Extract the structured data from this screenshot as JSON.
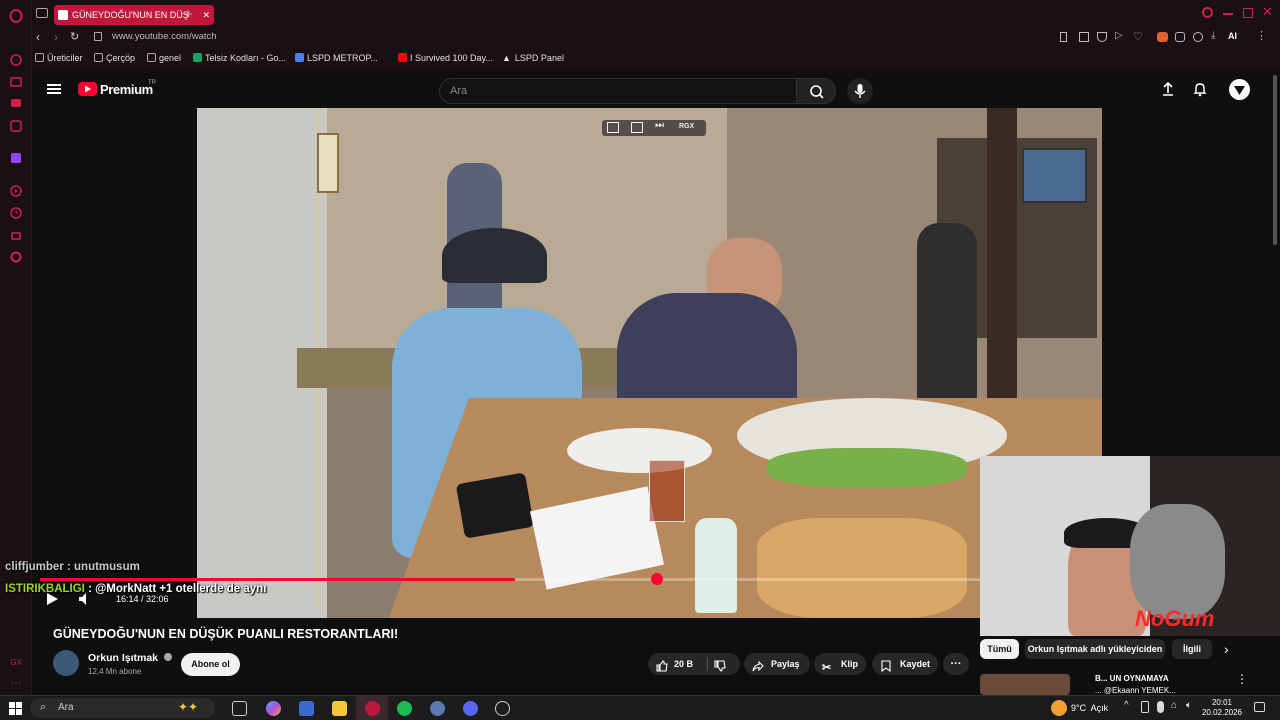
{
  "browser": {
    "tab_title": "GÜNEYDOĞU'NUN EN DÜŞ",
    "url": "www.youtube.com/watch",
    "ai_label": "AI",
    "bookmarks": [
      "Üreticiler",
      "Çerçöp",
      "genel",
      "Telsiz Kodları - Go...",
      "LSPD METROP...",
      "I Survived 100 Day...",
      "LSPD Panel"
    ]
  },
  "youtube": {
    "logo": "Premium",
    "region": "TR",
    "search_placeholder": "Ara",
    "video_overlay_label": "RGX",
    "video_title": "GÜNEYDOĞU'NUN EN DÜŞÜK PUANLI RESTORANTLARI!",
    "channel_name": "Orkun Işıtmak",
    "subscribers": "12,4 Mn abone",
    "subscribe_label": "Abone ol",
    "likes": "20 B",
    "share_label": "Paylaş",
    "clip_label": "Klip",
    "save_label": "Kaydet",
    "time": "16:14 / 32:06",
    "progress": 0.505,
    "chips": [
      "Tümü",
      "Orkun Işıtmak adlı yükleyiciden",
      "İlgili"
    ],
    "up_next_title_1": "B... UN OYNAMAYA",
    "up_next_title_2": "... @Ekaann YEMEK..."
  },
  "stream_chat": [
    {
      "user": "cliffjumber",
      "message": " : unutmusum",
      "color": "#c9c9c9"
    },
    {
      "user": "ISTIRIKBALIGI",
      "message": " : @MorkNatt +1 otellerde de aynı",
      "color": "#9bd42b"
    }
  ],
  "overlay_text": "NoGum",
  "taskbar": {
    "search_placeholder": "Ara",
    "weather": "9°C  Açık",
    "clock_time": "20:01",
    "clock_date": "20.02.2026"
  }
}
